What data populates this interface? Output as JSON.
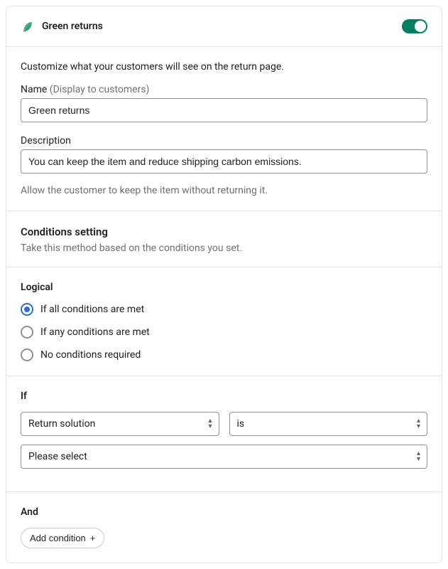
{
  "header": {
    "title": "Green returns",
    "toggle_on": true
  },
  "customize": {
    "intro": "Customize what your customers will see on the return page.",
    "name_label": "Name",
    "name_hint": "(Display to customers)",
    "name_value": "Green returns",
    "desc_label": "Description",
    "desc_value": "You can keep the item and reduce shipping carbon emissions.",
    "note": "Allow the customer to keep the item without returning it."
  },
  "conditions": {
    "heading": "Conditions setting",
    "sub": "Take this method based on the conditions you set."
  },
  "logical": {
    "title": "Logical",
    "options": [
      "If all conditions are met",
      "If any conditions are met",
      "No conditions required"
    ],
    "selected_index": 0
  },
  "if_block": {
    "title": "If",
    "field_select": "Return solution",
    "operator_select": "is",
    "value_select": "Please select"
  },
  "and_block": {
    "title": "And",
    "add_label": "Add condition"
  }
}
